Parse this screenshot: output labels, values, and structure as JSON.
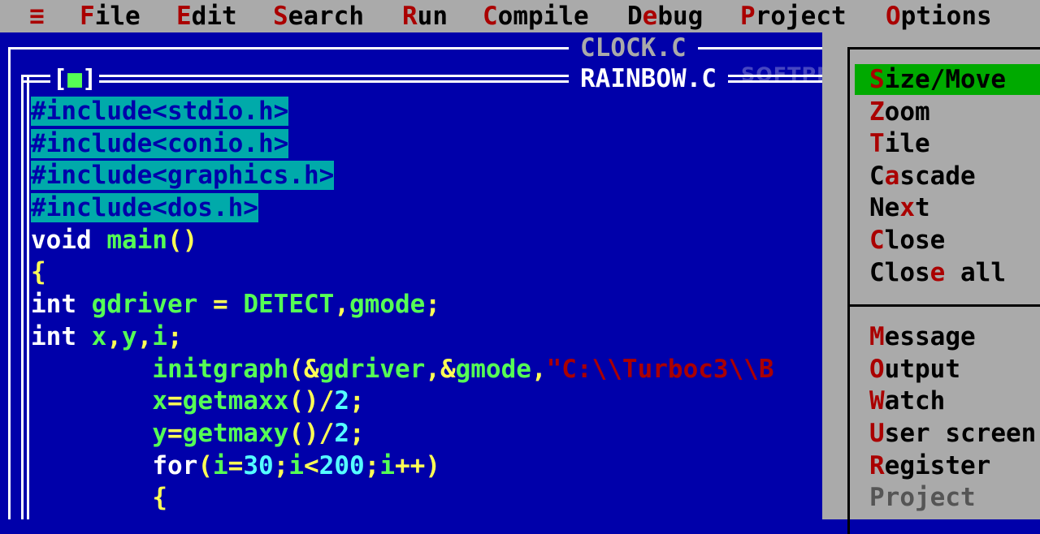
{
  "menubar": {
    "system_icon": "≡",
    "items": [
      {
        "hotkey": "F",
        "rest": "ile"
      },
      {
        "hotkey": "E",
        "rest": "dit"
      },
      {
        "hotkey": "S",
        "rest": "earch"
      },
      {
        "hotkey": "R",
        "rest": "un"
      },
      {
        "hotkey": "C",
        "rest": "ompile"
      },
      {
        "pre": "D",
        "hotkey": "e",
        "rest": "bug"
      },
      {
        "hotkey": "P",
        "rest": "roject"
      },
      {
        "hotkey": "O",
        "rest": "ptions"
      }
    ]
  },
  "windows": {
    "background_title": "CLOCK.C",
    "active_title": "RAINBOW.C",
    "close_box_left": "[",
    "close_box_mark": "■",
    "close_box_right": "]"
  },
  "watermark": "SOFTPEDIA",
  "code": {
    "line1": "#include<stdio.h>",
    "line2": "#include<conio.h>",
    "line3": "#include<graphics.h>",
    "line4": "#include<dos.h>",
    "line5_kw": "void",
    "line5_id": "main",
    "line5_pn": "()",
    "line6": "{",
    "line7_kw": "int",
    "line7_id1": "gdriver",
    "line7_eq": "=",
    "line7_id2": "DETECT",
    "line7_c": ",",
    "line7_id3": "gmode",
    "line7_sc": ";",
    "line8_kw": "int",
    "line8_a": "x",
    "line8_c1": ",",
    "line8_b": "y",
    "line8_c2": ",",
    "line8_c": "i",
    "line8_sc": ";",
    "line9_fn": "initgraph",
    "line9_p1": "(&",
    "line9_a1": "gdriver",
    "line9_p2": ",&",
    "line9_a2": "gmode",
    "line9_p3": ",",
    "line9_str": "\"C:\\\\Turboc3\\\\B",
    "line10_id": "x",
    "line10_eq": "=",
    "line10_fn": "getmaxx",
    "line10_op": "()/",
    "line10_num": "2",
    "line10_sc": ";",
    "line11_id": "y",
    "line11_eq": "=",
    "line11_fn": "getmaxy",
    "line11_op": "()/",
    "line11_num": "2",
    "line11_sc": ";",
    "line12_kw": "for",
    "line12_p1": "(",
    "line12_i1": "i",
    "line12_eq": "=",
    "line12_n1": "30",
    "line12_s1": ";",
    "line12_i2": "i",
    "line12_lt": "<",
    "line12_n2": "200",
    "line12_s2": ";",
    "line12_i3": "i",
    "line12_pp": "++)",
    "line13": "{"
  },
  "window_menu": {
    "items": [
      {
        "hotkey": "S",
        "rest": "ize/Move",
        "selected": true
      },
      {
        "hotkey": "Z",
        "rest": "oom"
      },
      {
        "hotkey": "T",
        "rest": "ile"
      },
      {
        "pre": "C",
        "hotkey": "a",
        "rest": "scade"
      },
      {
        "pre": "Ne",
        "hotkey": "x",
        "rest": "t"
      },
      {
        "hotkey": "C",
        "rest": "lose"
      },
      {
        "pre": "Clos",
        "hotkey": "e",
        "rest": " all"
      },
      {
        "hotkey": "M",
        "rest": "essage"
      },
      {
        "hotkey": "O",
        "rest": "utput"
      },
      {
        "hotkey": "W",
        "rest": "atch"
      },
      {
        "hotkey": "U",
        "rest": "ser screen"
      },
      {
        "hotkey": "R",
        "rest": "egister"
      },
      {
        "label": "Project",
        "disabled": true
      }
    ]
  },
  "colors": {
    "editor_bg": "#0000aa",
    "menu_bg": "#aaaaaa",
    "hotkey": "#aa0000",
    "selected_bg": "#00aa00",
    "highlight_bg": "#00aaaa"
  }
}
